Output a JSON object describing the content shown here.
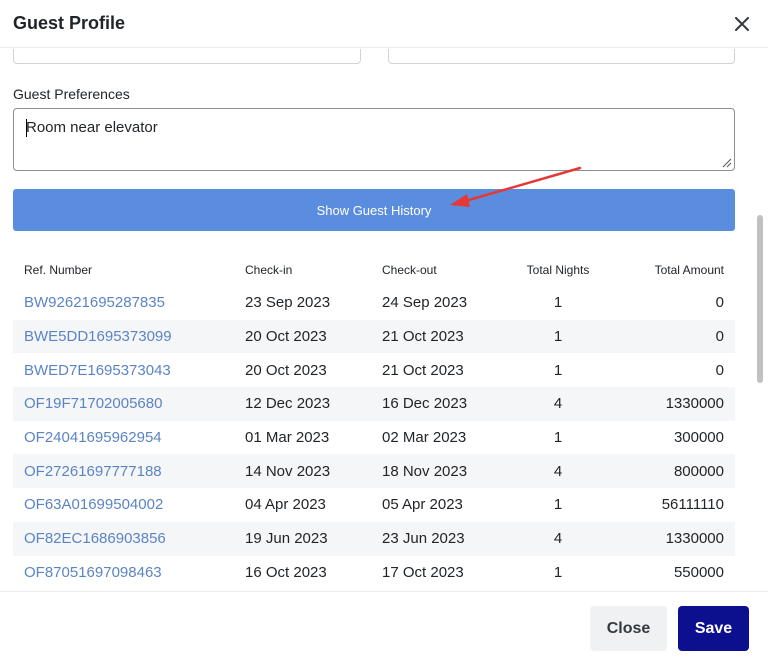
{
  "dialog": {
    "title": "Guest Profile"
  },
  "preferences": {
    "label": "Guest Preferences",
    "value": "Room near elevator"
  },
  "history_button": {
    "label": "Show Guest History"
  },
  "annotation": {
    "arrow_color": "#e53935"
  },
  "table": {
    "headers": {
      "ref": "Ref. Number",
      "checkin": "Check-in",
      "checkout": "Check-out",
      "nights": "Total Nights",
      "amount": "Total Amount"
    },
    "rows": [
      {
        "ref": "BW92621695287835",
        "checkin": "23 Sep 2023",
        "checkout": "24 Sep 2023",
        "nights": "1",
        "amount": "0"
      },
      {
        "ref": "BWE5DD1695373099",
        "checkin": "20 Oct 2023",
        "checkout": "21 Oct 2023",
        "nights": "1",
        "amount": "0"
      },
      {
        "ref": "BWED7E1695373043",
        "checkin": "20 Oct 2023",
        "checkout": "21 Oct 2023",
        "nights": "1",
        "amount": "0"
      },
      {
        "ref": "OF19F71702005680",
        "checkin": "12 Dec 2023",
        "checkout": "16 Dec 2023",
        "nights": "4",
        "amount": "1330000"
      },
      {
        "ref": "OF24041695962954",
        "checkin": "01 Mar 2023",
        "checkout": "02 Mar 2023",
        "nights": "1",
        "amount": "300000"
      },
      {
        "ref": "OF27261697777188",
        "checkin": "14 Nov 2023",
        "checkout": "18 Nov 2023",
        "nights": "4",
        "amount": "800000"
      },
      {
        "ref": "OF63A01699504002",
        "checkin": "04 Apr 2023",
        "checkout": "05 Apr 2023",
        "nights": "1",
        "amount": "56111110"
      },
      {
        "ref": "OF82EC1686903856",
        "checkin": "19 Jun 2023",
        "checkout": "23 Jun 2023",
        "nights": "4",
        "amount": "1330000"
      },
      {
        "ref": "OF87051697098463",
        "checkin": "16 Oct 2023",
        "checkout": "17 Oct 2023",
        "nights": "1",
        "amount": "550000"
      }
    ]
  },
  "footer": {
    "close_label": "Close",
    "save_label": "Save"
  },
  "colors": {
    "primary_button": "#5b8ddf",
    "save_button": "#0c0f8e",
    "link": "#5b84c4"
  }
}
